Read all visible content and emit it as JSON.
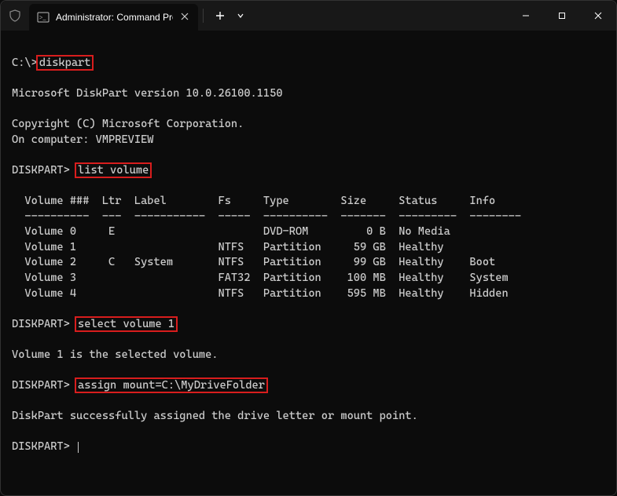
{
  "titlebar": {
    "tab_title": "Administrator: Command Pro"
  },
  "terminal": {
    "prompt0": "C:\\>",
    "cmd0": "diskpart",
    "banner1": "Microsoft DiskPart version 10.0.26100.1150",
    "banner2": "Copyright (C) Microsoft Corporation.",
    "banner3": "On computer: VMPREVIEW",
    "prompt": "DISKPART>",
    "cmd1": "list volume",
    "table": {
      "header": "  Volume ###  Ltr  Label        Fs     Type        Size     Status     Info",
      "divider": "  ----------  ---  -----------  -----  ----------  -------  ---------  --------",
      "rows": [
        "  Volume 0     E                       DVD-ROM         0 B  No Media",
        "  Volume 1                      NTFS   Partition     59 GB  Healthy",
        "  Volume 2     C   System       NTFS   Partition     99 GB  Healthy    Boot",
        "  Volume 3                      FAT32  Partition    100 MB  Healthy    System",
        "  Volume 4                      NTFS   Partition    595 MB  Healthy    Hidden"
      ]
    },
    "cmd2": "select volume 1",
    "resp2": "Volume 1 is the selected volume.",
    "cmd3": "assign mount=C:\\MyDriveFolder",
    "resp3": "DiskPart successfully assigned the drive letter or mount point."
  }
}
